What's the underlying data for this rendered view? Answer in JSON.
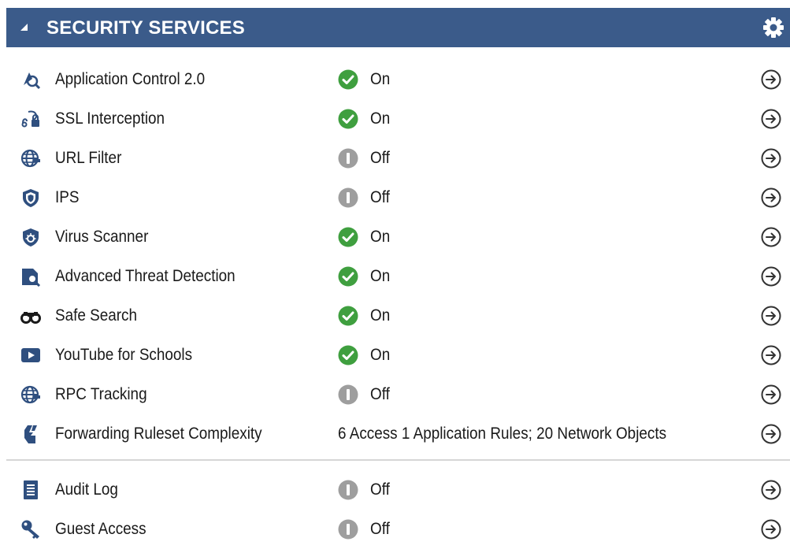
{
  "panel": {
    "title": "SECURITY SERVICES",
    "colors": {
      "header_bg": "#3b5b8a",
      "on": "#3f9f3f",
      "off": "#9e9e9e",
      "icon_blue": "#2f4f7f"
    }
  },
  "services": [
    {
      "label": "Application Control 2.0",
      "icon": "app-control-icon",
      "status": "On"
    },
    {
      "label": "SSL Interception",
      "icon": "ssl-interception-icon",
      "status": "On"
    },
    {
      "label": "URL Filter",
      "icon": "url-filter-icon",
      "status": "Off"
    },
    {
      "label": "IPS",
      "icon": "ips-shield-icon",
      "status": "Off"
    },
    {
      "label": "Virus Scanner",
      "icon": "virus-scanner-icon",
      "status": "On"
    },
    {
      "label": "Advanced Threat Detection",
      "icon": "threat-detection-icon",
      "status": "On"
    },
    {
      "label": "Safe Search",
      "icon": "binoculars-icon",
      "status": "On"
    },
    {
      "label": "YouTube for Schools",
      "icon": "youtube-icon",
      "status": "On"
    },
    {
      "label": "RPC Tracking",
      "icon": "rpc-tracking-icon",
      "status": "Off"
    },
    {
      "label": "Forwarding Ruleset Complexity",
      "icon": "ruleset-icon",
      "status": "6 Access 1 Application Rules; 20 Network Objects"
    }
  ],
  "extras": [
    {
      "label": "Audit Log",
      "icon": "audit-log-icon",
      "status": "Off"
    },
    {
      "label": "Guest Access",
      "icon": "key-icon",
      "status": "Off"
    }
  ]
}
